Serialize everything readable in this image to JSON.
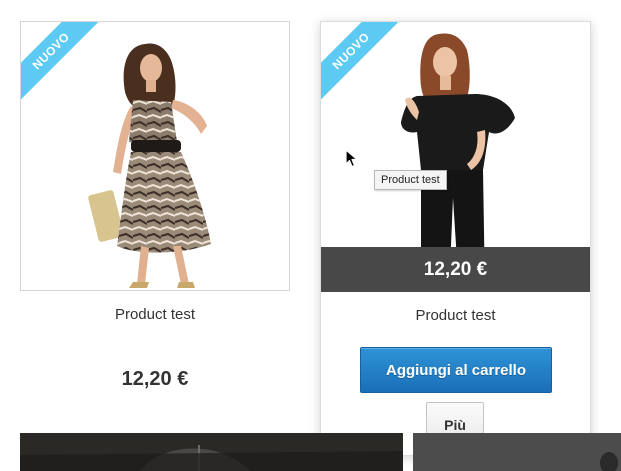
{
  "products": [
    {
      "badge": "NUOVO",
      "name": "Product test",
      "price": "12,20 €"
    },
    {
      "badge": "NUOVO",
      "name": "Product test",
      "price": "12,20 €",
      "add_to_cart_label": "Aggiungi al carrello",
      "more_label": "Più",
      "tooltip": "Product test"
    }
  ],
  "colors": {
    "ribbon": "#5ccaf3",
    "add_to_cart": "#1f7cc2",
    "price_bar": "#484848"
  }
}
